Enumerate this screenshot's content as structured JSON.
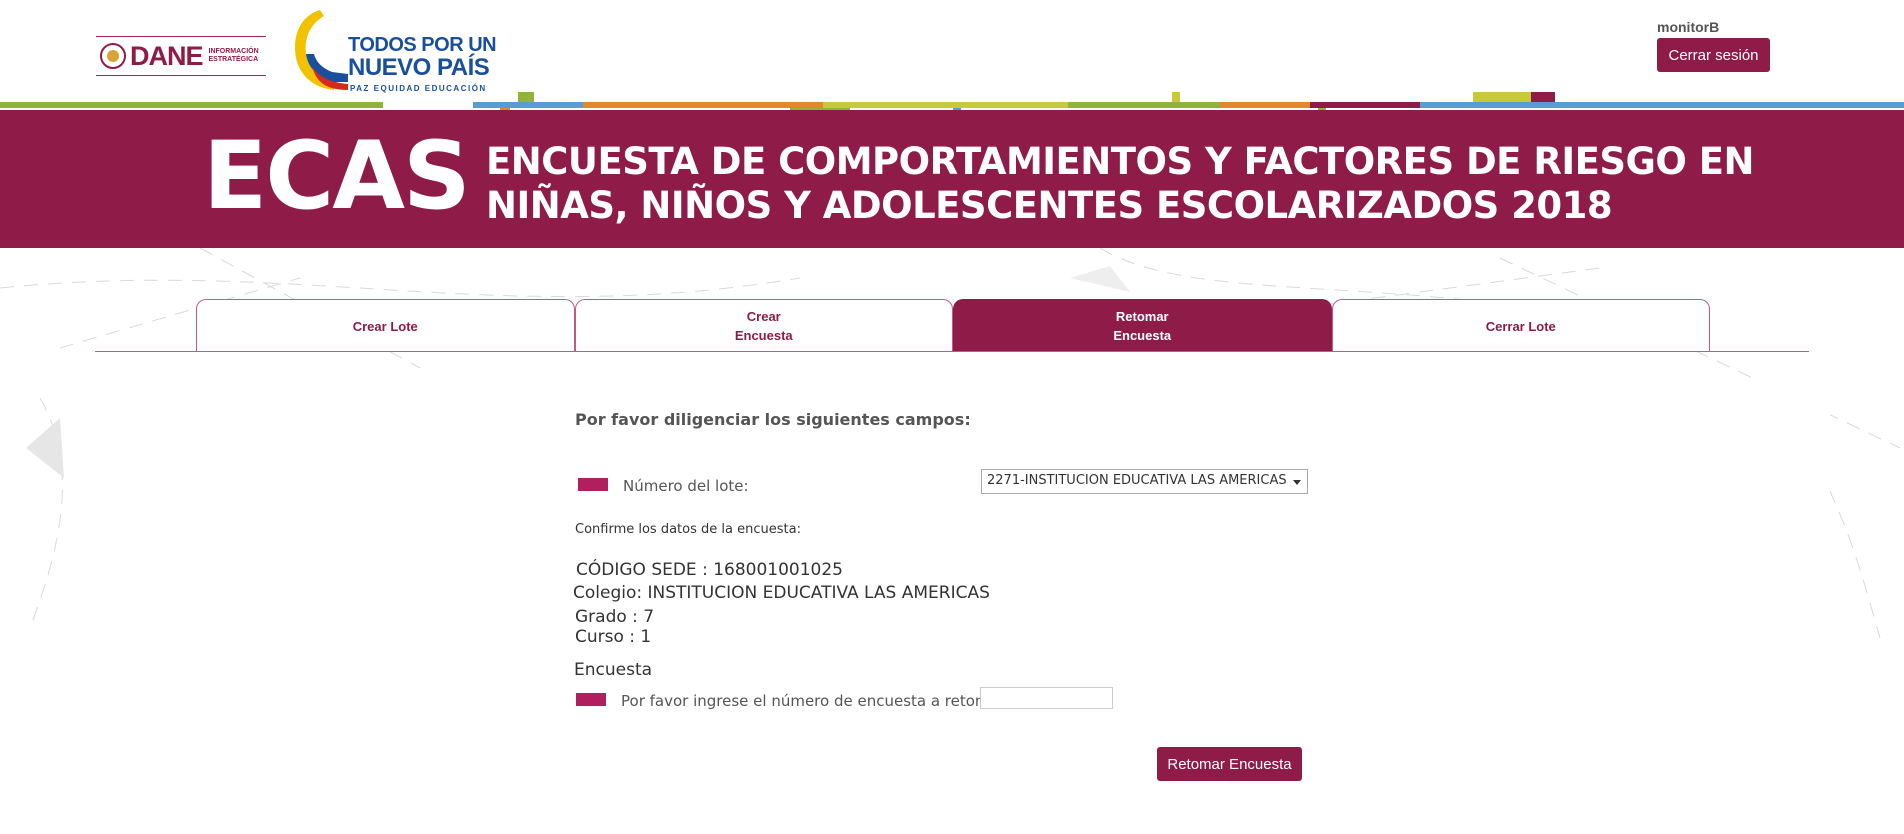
{
  "header": {
    "dane": {
      "brand": "DANE",
      "subtitle_line1": "INFORMACIÓN",
      "subtitle_line2": "ESTRATÉGICA"
    },
    "government_logo": {
      "line1": "TODOS POR UN",
      "line2": "NUEVO PAÍS",
      "line3": "PAZ  EQUIDAD  EDUCACIÓN"
    },
    "user": "monitorB",
    "logout_label": "Cerrar sesión"
  },
  "banner": {
    "acronym": "ECAS",
    "title_line1": "ENCUESTA DE COMPORTAMIENTOS Y FACTORES DE RIESGO EN",
    "title_line2": "NIÑAS, NIÑOS Y ADOLESCENTES ESCOLARIZADOS 2018",
    "background_color": "#8e1b48"
  },
  "tabs": [
    {
      "line1": "Crear Lote",
      "line2": "",
      "active": false
    },
    {
      "line1": "Crear",
      "line2": "Encuesta",
      "active": false
    },
    {
      "line1": "Retomar",
      "line2": "Encuesta",
      "active": true
    },
    {
      "line1": "Cerrar Lote",
      "line2": "",
      "active": false
    }
  ],
  "form": {
    "intro": "Por favor diligenciar los siguientes campos:",
    "lote_label": "Número del lote:",
    "lote_selected": "2271-INSTITUCION EDUCATIVA LAS AMERICAS",
    "confirm_text": "Confirme los datos de la encuesta:",
    "codigo_sede": "CÓDIGO SEDE : 168001001025",
    "colegio": "Colegio: INSTITUCION EDUCATIVA LAS AMERICAS",
    "grado": "Grado : 7",
    "curso": "Curso : 1",
    "section_title": "Encuesta",
    "encuesta_label": "Por favor ingrese el número de encuesta a retomar",
    "encuesta_value": "",
    "submit_label": "Retomar Encuesta"
  },
  "colors": {
    "accent": "#8e1b48",
    "required_marker": "#b01f5e"
  }
}
